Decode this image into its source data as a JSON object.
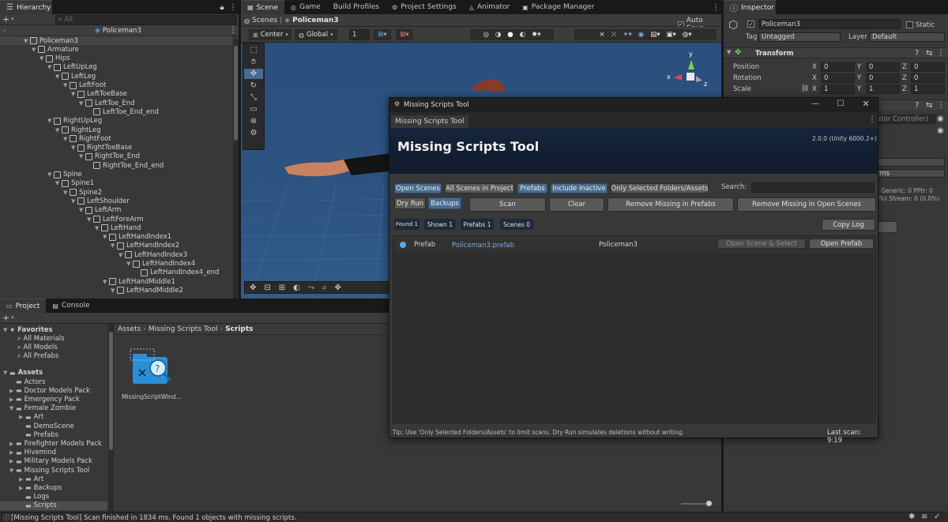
{
  "hierarchy": {
    "tab": "Hierarchy",
    "search_placeholder": "All",
    "add_label": "+",
    "scene_title": "Policeman3",
    "items": [
      {
        "label": "Policeman3",
        "depth": 0
      },
      {
        "label": "Armature",
        "depth": 1
      },
      {
        "label": "Hips",
        "depth": 2
      },
      {
        "label": "LeftUpLeg",
        "depth": 3
      },
      {
        "label": "LeftLeg",
        "depth": 4
      },
      {
        "label": "LeftFoot",
        "depth": 5
      },
      {
        "label": "LeftToeBase",
        "depth": 6
      },
      {
        "label": "LeftToe_End",
        "depth": 7
      },
      {
        "label": "LeftToe_End_end",
        "depth": 8
      },
      {
        "label": "RightUpLeg",
        "depth": 3
      },
      {
        "label": "RightLeg",
        "depth": 4
      },
      {
        "label": "RightFoot",
        "depth": 5
      },
      {
        "label": "RightToeBase",
        "depth": 6
      },
      {
        "label": "RightToe_End",
        "depth": 7
      },
      {
        "label": "RightToe_End_end",
        "depth": 8
      },
      {
        "label": "Spine",
        "depth": 3
      },
      {
        "label": "Spine1",
        "depth": 4
      },
      {
        "label": "Spine2",
        "depth": 5
      },
      {
        "label": "LeftShoulder",
        "depth": 6
      },
      {
        "label": "LeftArm",
        "depth": 7
      },
      {
        "label": "LeftForeArm",
        "depth": 8
      },
      {
        "label": "LeftHand",
        "depth": 9
      },
      {
        "label": "LeftHandIndex1",
        "depth": 10
      },
      {
        "label": "LeftHandIndex2",
        "depth": 11
      },
      {
        "label": "LeftHandIndex3",
        "depth": 12
      },
      {
        "label": "LeftHandIndex4",
        "depth": 13
      },
      {
        "label": "LeftHandIndex4_end",
        "depth": 14
      },
      {
        "label": "LeftHandMiddle1",
        "depth": 10
      },
      {
        "label": "LeftHandMiddle2",
        "depth": 11
      }
    ]
  },
  "scene": {
    "tabs": [
      "Scene",
      "Game",
      "Build Profiles",
      "Project Settings",
      "Animator",
      "Package Manager"
    ],
    "auto_save": "Auto Save",
    "breadcrumb_root": "Scenes",
    "breadcrumb_item": "Policeman3",
    "pivot": "Center",
    "space": "Global",
    "snap_value": "1",
    "gizmo_y": "y",
    "gizmo_x": "x",
    "gizmo_z": "z"
  },
  "inspector": {
    "tab": "Inspector",
    "object_name": "Policeman3",
    "static": "Static",
    "tag_label": "Tag",
    "tag_value": "Untagged",
    "layer_label": "Layer",
    "layer_value": "Default",
    "transform_title": "Transform",
    "position_label": "Position",
    "rotation_label": "Rotation",
    "scale_label": "Scale",
    "axis_x": "X",
    "axis_y": "Y",
    "axis_z": "Z",
    "position": [
      "0",
      "0",
      "0"
    ],
    "rotation": [
      "0",
      "0",
      "0"
    ],
    "scale": [
      "1",
      "1",
      "1"
    ],
    "animator_controller": "ator Controller)",
    "rms": "rms",
    "stats_line1": "0 Generic: 0 PPtr: 0",
    "stats_line2": "0%) Stream: 0 (0.0%)"
  },
  "project": {
    "tabs": [
      "Project",
      "Console"
    ],
    "favorites_title": "Favorites",
    "favorites": [
      "All Materials",
      "All Models",
      "All Prefabs"
    ],
    "assets_title": "Assets",
    "folders": [
      {
        "label": "Actors",
        "depth": 1
      },
      {
        "label": "Doctor Models Pack",
        "depth": 1
      },
      {
        "label": "Emergency Pack",
        "depth": 1
      },
      {
        "label": "Female Zombie",
        "depth": 1
      },
      {
        "label": "Art",
        "depth": 2
      },
      {
        "label": "DemoScene",
        "depth": 2
      },
      {
        "label": "Prefabs",
        "depth": 2
      },
      {
        "label": "Firefighter Models Pack",
        "depth": 1
      },
      {
        "label": "Hivemind",
        "depth": 1
      },
      {
        "label": "Military Models Pack",
        "depth": 1
      },
      {
        "label": "Missing Scripts Tool",
        "depth": 1
      },
      {
        "label": "Art",
        "depth": 2
      },
      {
        "label": "Backups",
        "depth": 2
      },
      {
        "label": "Logs",
        "depth": 2
      },
      {
        "label": "Scripts",
        "depth": 2
      }
    ],
    "path": [
      "Assets",
      "Missing Scripts Tool",
      "Scripts"
    ],
    "asset_name": "MissingScriptWind..."
  },
  "tool": {
    "window_title": "Missing Scripts Tool",
    "tab": "Missing Scripts Tool",
    "header_title": "Missing Scripts Tool",
    "version": "2.0.0 (Unity 6000.2+)",
    "filters": [
      "Open Scenes",
      "All Scenes in Project",
      "Prefabs",
      "Include Inactive",
      "Only Selected Folders/Assets"
    ],
    "search_label": "Search:",
    "dry_run": "Dry Run",
    "backups": "Backups",
    "scan": "Scan",
    "clear": "Clear",
    "remove_prefabs": "Remove Missing in Prefabs",
    "remove_scenes": "Remove Missing in Open Scenes",
    "badge_found": "Found 1",
    "badge_shown": "Shown 1",
    "badge_prefabs": "Prefabs 1",
    "badge_scenes": "Scenes 0",
    "copy_log": "Copy Log",
    "result_type": "Prefab",
    "result_path": "Policeman3.prefab",
    "result_object": "Policeman3",
    "open_scene_select": "Open Scene & Select",
    "open_prefab": "Open Prefab",
    "tip": "Tip: Use 'Only Selected Folders/Assets' to limit scans. Dry Run simulates deletions without writing.",
    "last_scan": "Last scan: 9:19"
  },
  "status": {
    "message": "[Missing Scripts Tool] Scan finished in 1834 ms. Found 1 objects with missing scripts."
  },
  "colors": {
    "accent": "#4a6b8f",
    "scene_sky": "#2e5380",
    "link": "#7fa9d8"
  }
}
